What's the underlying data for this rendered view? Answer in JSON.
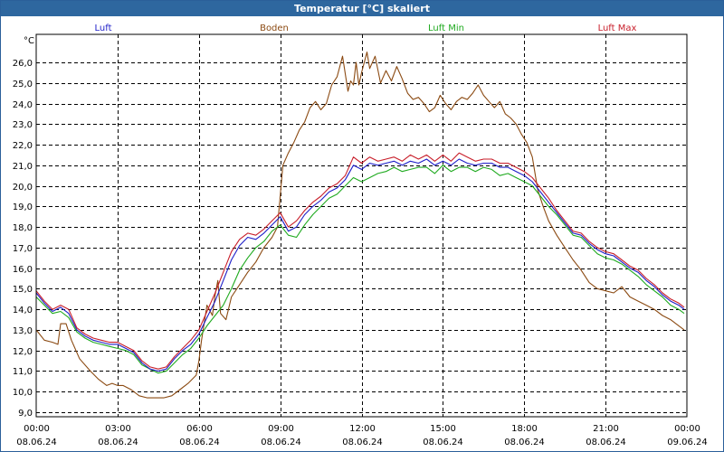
{
  "window": {
    "title": "Temperatur [°C] skaliert"
  },
  "chart_data": {
    "type": "line",
    "title": "Temperatur [°C] skaliert",
    "ylabel": "°C",
    "xlabel": "",
    "ylim": [
      8.8,
      27.0
    ],
    "xlim": [
      0,
      24
    ],
    "grid": true,
    "legend_placement": "top",
    "y_ticks": [
      "9,0",
      "10,0",
      "11,0",
      "12,0",
      "13,0",
      "14,0",
      "15,0",
      "16,0",
      "17,0",
      "18,0",
      "19,0",
      "20,0",
      "21,0",
      "22,0",
      "23,0",
      "24,0",
      "25,0",
      "26,0"
    ],
    "y_tick_values": [
      9,
      10,
      11,
      12,
      13,
      14,
      15,
      16,
      17,
      18,
      19,
      20,
      21,
      22,
      23,
      24,
      25,
      26
    ],
    "x_ticks": [
      {
        "hour": 0,
        "time": "00:00",
        "date": "08.06.24"
      },
      {
        "hour": 3,
        "time": "03:00",
        "date": "08.06.24"
      },
      {
        "hour": 6,
        "time": "06:00",
        "date": "08.06.24"
      },
      {
        "hour": 9,
        "time": "09:00",
        "date": "08.06.24"
      },
      {
        "hour": 12,
        "time": "12:00",
        "date": "08.06.24"
      },
      {
        "hour": 15,
        "time": "15:00",
        "date": "08.06.24"
      },
      {
        "hour": 18,
        "time": "18:00",
        "date": "08.06.24"
      },
      {
        "hour": 21,
        "time": "21:00",
        "date": "08.06.24"
      },
      {
        "hour": 24,
        "time": "00:00",
        "date": "09.06.24"
      }
    ],
    "series": [
      {
        "name": "Boden",
        "color": "#8b4a12",
        "x": [
          0,
          0.3,
          0.6,
          0.8,
          0.9,
          1.1,
          1.3,
          1.6,
          2.0,
          2.3,
          2.6,
          2.8,
          3.0,
          3.2,
          3.5,
          3.8,
          4.1,
          4.4,
          4.7,
          5.0,
          5.3,
          5.6,
          5.9,
          6.0,
          6.1,
          6.3,
          6.5,
          6.6,
          6.7,
          6.8,
          7.0,
          7.2,
          7.5,
          7.8,
          8.1,
          8.4,
          8.7,
          8.9,
          9.0,
          9.1,
          9.3,
          9.5,
          9.7,
          9.9,
          10.1,
          10.3,
          10.5,
          10.7,
          10.9,
          11.1,
          11.3,
          11.5,
          11.6,
          11.7,
          11.8,
          11.9,
          12.0,
          12.2,
          12.3,
          12.5,
          12.7,
          12.9,
          13.1,
          13.3,
          13.5,
          13.7,
          13.9,
          14.1,
          14.3,
          14.5,
          14.7,
          14.9,
          15.1,
          15.3,
          15.5,
          15.7,
          15.9,
          16.1,
          16.3,
          16.5,
          16.7,
          16.9,
          17.1,
          17.3,
          17.5,
          17.7,
          17.9,
          18.1,
          18.3,
          18.5,
          18.7,
          18.9,
          19.2,
          19.5,
          19.8,
          20.1,
          20.4,
          20.7,
          21.0,
          21.3,
          21.6,
          21.9,
          22.2,
          22.5,
          22.8,
          23.1,
          23.4,
          23.7,
          23.9
        ],
        "y": [
          13.0,
          12.5,
          12.4,
          12.3,
          13.3,
          13.3,
          12.5,
          11.6,
          11.0,
          10.6,
          10.3,
          10.4,
          10.3,
          10.3,
          10.1,
          9.8,
          9.7,
          9.7,
          9.7,
          9.8,
          10.1,
          10.4,
          10.8,
          11.5,
          12.5,
          14.2,
          13.7,
          14.7,
          15.4,
          13.8,
          13.5,
          14.6,
          15.2,
          15.8,
          16.3,
          17.0,
          17.5,
          18.0,
          19.5,
          21.0,
          21.6,
          22.1,
          22.7,
          23.1,
          23.8,
          24.1,
          23.7,
          24.0,
          24.9,
          25.3,
          26.3,
          24.6,
          25.1,
          24.9,
          26.0,
          24.9,
          25.5,
          26.5,
          25.7,
          26.3,
          25.0,
          25.6,
          25.1,
          25.8,
          25.2,
          24.5,
          24.2,
          24.3,
          24.0,
          23.6,
          23.8,
          24.4,
          24.0,
          23.7,
          24.1,
          24.3,
          24.2,
          24.5,
          24.9,
          24.4,
          24.1,
          23.8,
          24.1,
          23.5,
          23.3,
          23.0,
          22.5,
          22.1,
          21.4,
          19.8,
          19.0,
          18.3,
          17.6,
          17.0,
          16.4,
          15.9,
          15.3,
          15.0,
          14.9,
          14.8,
          15.1,
          14.6,
          14.4,
          14.2,
          14.0,
          13.7,
          13.5,
          13.2,
          13.0
        ]
      },
      {
        "name": "Luft Min",
        "color": "#1faa1f",
        "x": [
          0,
          0.3,
          0.6,
          0.9,
          1.2,
          1.5,
          1.8,
          2.1,
          2.4,
          2.7,
          3.0,
          3.3,
          3.6,
          3.9,
          4.2,
          4.5,
          4.8,
          5.1,
          5.4,
          5.7,
          6.0,
          6.3,
          6.6,
          6.9,
          7.2,
          7.5,
          7.8,
          8.1,
          8.4,
          8.7,
          9.0,
          9.3,
          9.6,
          9.9,
          10.2,
          10.5,
          10.8,
          11.1,
          11.4,
          11.7,
          12.0,
          12.3,
          12.6,
          12.9,
          13.2,
          13.5,
          13.8,
          14.1,
          14.4,
          14.7,
          15.0,
          15.3,
          15.6,
          15.9,
          16.2,
          16.5,
          16.8,
          17.1,
          17.4,
          17.7,
          18.0,
          18.3,
          18.6,
          18.9,
          19.2,
          19.5,
          19.8,
          20.1,
          20.4,
          20.7,
          21.0,
          21.3,
          21.6,
          21.9,
          22.2,
          22.5,
          22.8,
          23.1,
          23.4,
          23.7,
          23.9
        ],
        "y": [
          14.6,
          14.2,
          13.8,
          13.9,
          13.6,
          12.9,
          12.6,
          12.4,
          12.3,
          12.2,
          12.1,
          12.0,
          11.8,
          11.3,
          11.1,
          10.9,
          11.0,
          11.4,
          11.8,
          12.1,
          12.6,
          13.2,
          13.7,
          14.2,
          15.0,
          15.9,
          16.5,
          17.0,
          17.3,
          17.8,
          18.1,
          17.6,
          17.5,
          18.1,
          18.6,
          19.0,
          19.4,
          19.6,
          20.0,
          20.4,
          20.2,
          20.4,
          20.6,
          20.7,
          20.9,
          20.7,
          20.8,
          20.9,
          20.9,
          20.6,
          21.0,
          20.7,
          20.9,
          20.9,
          20.7,
          20.9,
          20.8,
          20.5,
          20.6,
          20.4,
          20.2,
          20.0,
          19.5,
          19.0,
          18.6,
          18.1,
          17.6,
          17.5,
          17.1,
          16.7,
          16.5,
          16.4,
          16.2,
          15.9,
          15.6,
          15.2,
          14.9,
          14.6,
          14.2,
          14.0,
          13.8
        ]
      },
      {
        "name": "Luft",
        "color": "#1e1ec8",
        "x": [
          0,
          0.3,
          0.6,
          0.9,
          1.2,
          1.5,
          1.8,
          2.1,
          2.4,
          2.7,
          3.0,
          3.3,
          3.6,
          3.9,
          4.2,
          4.5,
          4.8,
          5.1,
          5.4,
          5.7,
          6.0,
          6.3,
          6.6,
          6.9,
          7.2,
          7.5,
          7.8,
          8.1,
          8.4,
          8.7,
          9.0,
          9.3,
          9.6,
          9.9,
          10.2,
          10.5,
          10.8,
          11.1,
          11.4,
          11.7,
          12.0,
          12.3,
          12.6,
          12.9,
          13.2,
          13.5,
          13.8,
          14.1,
          14.4,
          14.7,
          15.0,
          15.3,
          15.6,
          15.9,
          16.2,
          16.5,
          16.8,
          17.1,
          17.4,
          17.7,
          18.0,
          18.3,
          18.6,
          18.9,
          19.2,
          19.5,
          19.8,
          20.1,
          20.4,
          20.7,
          21.0,
          21.3,
          21.6,
          21.9,
          22.2,
          22.5,
          22.8,
          23.1,
          23.4,
          23.7,
          23.9
        ],
        "y": [
          14.8,
          14.3,
          13.9,
          14.1,
          13.8,
          13.0,
          12.7,
          12.5,
          12.4,
          12.3,
          12.3,
          12.1,
          11.9,
          11.4,
          11.1,
          11.0,
          11.1,
          11.6,
          12.0,
          12.3,
          12.8,
          13.6,
          14.4,
          15.4,
          16.4,
          17.1,
          17.5,
          17.4,
          17.7,
          18.1,
          18.5,
          17.8,
          18.0,
          18.6,
          19.0,
          19.3,
          19.7,
          19.9,
          20.3,
          21.0,
          20.8,
          21.1,
          21.0,
          21.1,
          21.2,
          21.0,
          21.2,
          21.1,
          21.3,
          21.0,
          21.2,
          21.0,
          21.3,
          21.1,
          21.0,
          21.1,
          21.1,
          20.9,
          20.9,
          20.7,
          20.5,
          20.2,
          19.7,
          19.2,
          18.7,
          18.2,
          17.7,
          17.6,
          17.2,
          16.9,
          16.7,
          16.6,
          16.3,
          16.0,
          15.8,
          15.4,
          15.1,
          14.7,
          14.4,
          14.2,
          14.0
        ]
      },
      {
        "name": "Luft Max",
        "color": "#c81e2a",
        "x": [
          0,
          0.3,
          0.6,
          0.9,
          1.2,
          1.5,
          1.8,
          2.1,
          2.4,
          2.7,
          3.0,
          3.3,
          3.6,
          3.9,
          4.2,
          4.5,
          4.8,
          5.1,
          5.4,
          5.7,
          6.0,
          6.3,
          6.6,
          6.9,
          7.2,
          7.5,
          7.8,
          8.1,
          8.4,
          8.7,
          9.0,
          9.3,
          9.6,
          9.9,
          10.2,
          10.5,
          10.8,
          11.1,
          11.4,
          11.7,
          12.0,
          12.3,
          12.6,
          12.9,
          13.2,
          13.5,
          13.8,
          14.1,
          14.4,
          14.7,
          15.0,
          15.3,
          15.6,
          15.9,
          16.2,
          16.5,
          16.8,
          17.1,
          17.4,
          17.7,
          18.0,
          18.3,
          18.6,
          18.9,
          19.2,
          19.5,
          19.8,
          20.1,
          20.4,
          20.7,
          21.0,
          21.3,
          21.6,
          21.9,
          22.2,
          22.5,
          22.8,
          23.1,
          23.4,
          23.7,
          23.9
        ],
        "y": [
          14.9,
          14.4,
          14.0,
          14.2,
          14.0,
          13.1,
          12.8,
          12.6,
          12.5,
          12.4,
          12.4,
          12.2,
          12.0,
          11.5,
          11.2,
          11.1,
          11.2,
          11.7,
          12.1,
          12.5,
          13.0,
          13.9,
          14.8,
          15.8,
          16.8,
          17.4,
          17.7,
          17.6,
          17.9,
          18.3,
          18.7,
          18.0,
          18.3,
          18.8,
          19.2,
          19.5,
          19.9,
          20.1,
          20.5,
          21.4,
          21.1,
          21.4,
          21.2,
          21.3,
          21.4,
          21.2,
          21.5,
          21.3,
          21.5,
          21.2,
          21.5,
          21.2,
          21.6,
          21.4,
          21.2,
          21.3,
          21.3,
          21.1,
          21.1,
          20.9,
          20.7,
          20.4,
          19.9,
          19.4,
          18.8,
          18.3,
          17.8,
          17.7,
          17.3,
          17.0,
          16.8,
          16.7,
          16.4,
          16.1,
          15.9,
          15.5,
          15.2,
          14.8,
          14.5,
          14.3,
          14.1
        ]
      }
    ]
  }
}
